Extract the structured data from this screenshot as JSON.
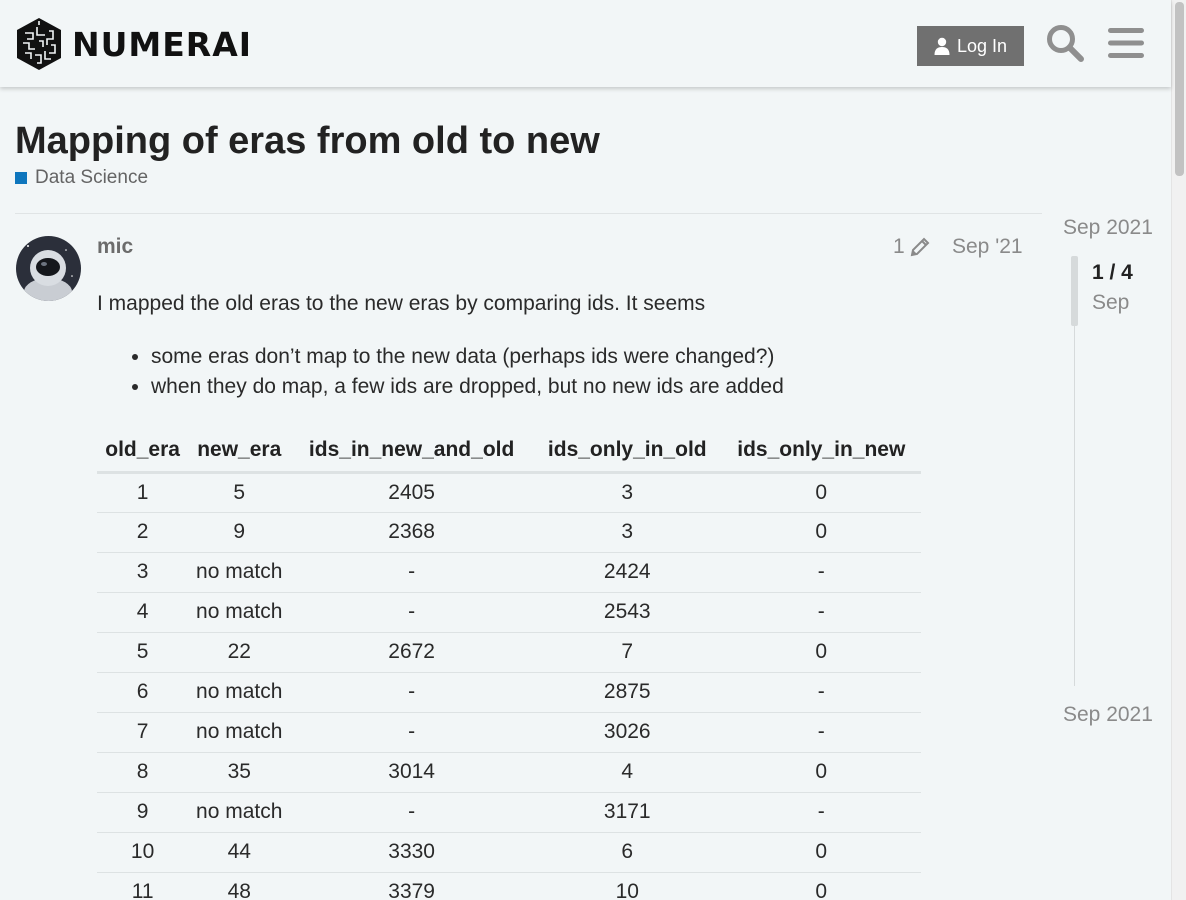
{
  "header": {
    "logo_text": "NUMERAI",
    "login_label": "Log In",
    "search_icon": "search-icon",
    "menu_icon": "hamburger-menu-icon"
  },
  "topic": {
    "title": "Mapping of eras from old to new",
    "category": "Data Science",
    "category_color": "#0e76bd"
  },
  "post": {
    "username": "mic",
    "edit_count": "1",
    "date": "Sep '21",
    "intro": "I mapped the old eras to the new eras by comparing ids. It seems",
    "bullets": [
      "some eras don’t map to the new data (perhaps ids were changed?)",
      "when they do map, a few ids are dropped, but no new ids are added"
    ],
    "table": {
      "headers": [
        "old_era",
        "new_era",
        "ids_in_new_and_old",
        "ids_only_in_old",
        "ids_only_in_new"
      ],
      "rows": [
        [
          "1",
          "5",
          "2405",
          "3",
          "0"
        ],
        [
          "2",
          "9",
          "2368",
          "3",
          "0"
        ],
        [
          "3",
          "no match",
          "-",
          "2424",
          "-"
        ],
        [
          "4",
          "no match",
          "-",
          "2543",
          "-"
        ],
        [
          "5",
          "22",
          "2672",
          "7",
          "0"
        ],
        [
          "6",
          "no match",
          "-",
          "2875",
          "-"
        ],
        [
          "7",
          "no match",
          "-",
          "3026",
          "-"
        ],
        [
          "8",
          "35",
          "3014",
          "4",
          "0"
        ],
        [
          "9",
          "no match",
          "-",
          "3171",
          "-"
        ],
        [
          "10",
          "44",
          "3330",
          "6",
          "0"
        ],
        [
          "11",
          "48",
          "3379",
          "10",
          "0"
        ]
      ]
    }
  },
  "timeline": {
    "start_date": "Sep 2021",
    "position": "1 / 4",
    "month": "Sep",
    "end_date": "Sep 2021"
  }
}
